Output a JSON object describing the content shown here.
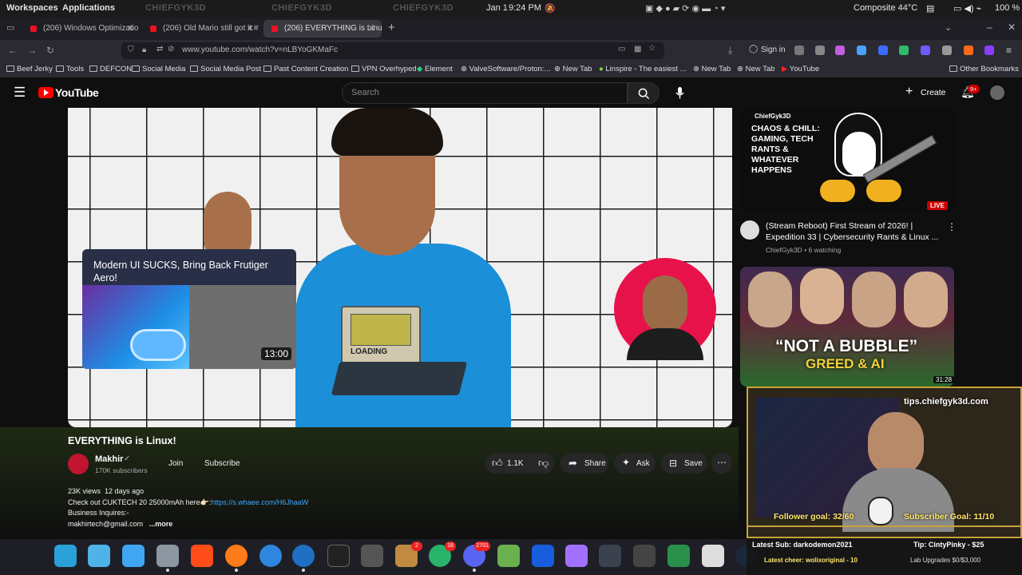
{
  "system_bar": {
    "workspaces": "Workspaces",
    "applications": "Applications",
    "ghost1": "CHIEFGYK3D",
    "ghost2": "CHIEFGYK3D",
    "ghost3": "CHIEFGYK3D",
    "date": "Jan 1",
    "time": "9:24 PM",
    "temp": "Composite 44°C",
    "battery": "100 %"
  },
  "tabs": [
    {
      "label": "(206) Windows Optimizatio"
    },
    {
      "label": "(206) Old Mario still got it #"
    },
    {
      "label": "(206) EVERYTHING is Linux!"
    }
  ],
  "url": "www.youtube.com/watch?v=nLBYoGKMaFc",
  "sign_in": "Sign in",
  "bookmarks": [
    "Beef Jerky",
    "Tools",
    "DEFCON",
    "Social Media",
    "Social Media Post",
    "Past Content Creation",
    "VPN Overhyped",
    "Element",
    "ValveSoftware/Proton:...",
    "New Tab",
    "Linspire - The easiest ...",
    "New Tab",
    "New Tab",
    "YouTube"
  ],
  "other_bookmarks": "Other Bookmarks",
  "youtube": {
    "logo": "YouTube",
    "search_placeholder": "Search",
    "create": "Create",
    "notif_badge": "9+"
  },
  "video": {
    "inset_title": "Modern UI SUCKS, Bring Back Frutiger Aero!",
    "inset_duration": "13:00",
    "loading_text": "LOADING",
    "title": "EVERYTHING is Linux!",
    "channel": "Makhir",
    "subscribers": "170K subscribers",
    "join": "Join",
    "subscribe": "Subscribe",
    "likes": "1.1K",
    "share": "Share",
    "ask": "Ask",
    "save": "Save",
    "views": "23K views",
    "age": "12 days ago",
    "desc_line1": "Check out CUKTECH 20 25000mAh here👉🏻:",
    "desc_link": "https://s.whaee.com/H6JhaaW",
    "desc_line2": "Business Inquires:-",
    "desc_line3": "makhirtech@gmail.com",
    "more": "...more"
  },
  "sidebar": {
    "live_thumb_brand": "ChiefGyk3D",
    "live_thumb_text": "CHAOS & CHILL: GAMING, TECH RANTS & WHATEVER HAPPENS",
    "live_badge": "LIVE",
    "item1_title": "(Stream Reboot) First Stream of 2026! | Expedition 33 | Cybersecurity Rants & Linux ...",
    "item1_channel": "ChiefGyk3D",
    "item1_meta": "6 watching",
    "item2_thumb_text1": "“NOT A BUBBLE”",
    "item2_thumb_text2": "GREED & AI",
    "item2_duration": "31:28"
  },
  "overlay": {
    "tips": "tips.chiefgyk3d.com",
    "follower_goal": "Follower goal: 32/60",
    "subscriber_goal": "Subscriber Goal: 11/10",
    "latest_sub": "Latest Sub: darkodemon2021",
    "tip": "Tip: CintyPinky - $25",
    "latest_cheer": "Latest cheer: wolixoriginal - 10",
    "lab": "Lab Upgrades $0/$3,000"
  },
  "dock": {
    "badges": [
      "2",
      "18",
      "2701"
    ]
  }
}
